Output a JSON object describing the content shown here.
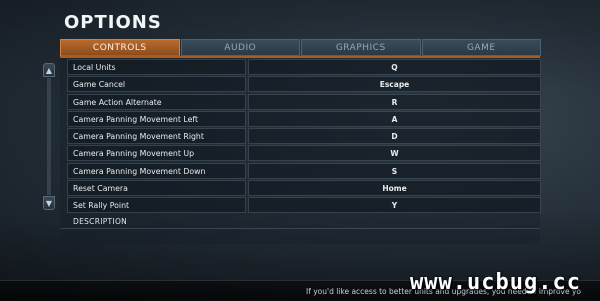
{
  "screen": {
    "title": "OPTIONS"
  },
  "tabs": [
    {
      "label": "CONTROLS",
      "active": true
    },
    {
      "label": "AUDIO",
      "active": false
    },
    {
      "label": "GRAPHICS",
      "active": false
    },
    {
      "label": "GAME",
      "active": false
    }
  ],
  "bindings": [
    {
      "action": "Local Units",
      "key": "Q"
    },
    {
      "action": "Game Cancel",
      "key": "Escape"
    },
    {
      "action": "Game Action Alternate",
      "key": "R"
    },
    {
      "action": "Camera Panning Movement Left",
      "key": "A"
    },
    {
      "action": "Camera Panning Movement Right",
      "key": "D"
    },
    {
      "action": "Camera Panning Movement Up",
      "key": "W"
    },
    {
      "action": "Camera Panning Movement Down",
      "key": "S"
    },
    {
      "action": "Reset Camera",
      "key": "Home"
    },
    {
      "action": "Set Rally Point",
      "key": "Y"
    }
  ],
  "description": {
    "label": "DESCRIPTION"
  },
  "scroll": {
    "up_icon": "▲",
    "down_icon": "▼"
  },
  "footer": {
    "text": "If you'd like access to better units and upgrades, you need to improve yo"
  },
  "watermark": {
    "text": "www.ucbug.cc"
  },
  "colors": {
    "accent": "#a85c22",
    "panel": "#25303a"
  }
}
